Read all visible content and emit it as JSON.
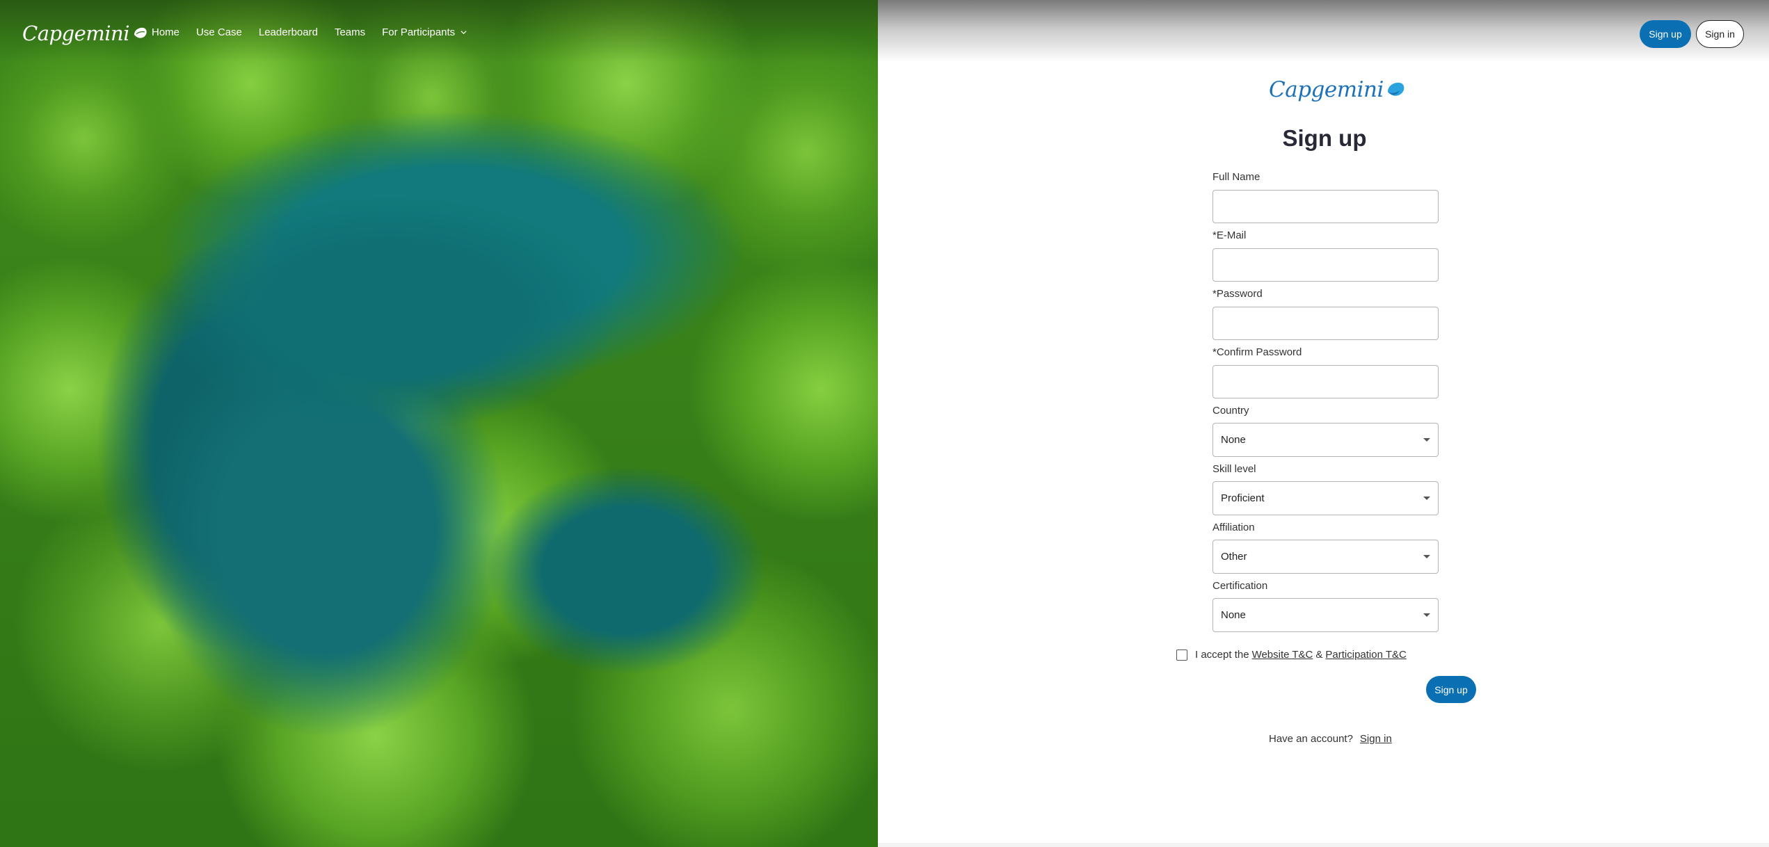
{
  "brand": {
    "name": "Capgemini",
    "brand_color": "#1d71b8"
  },
  "nav": {
    "items": [
      {
        "label": "Home"
      },
      {
        "label": "Use Case"
      },
      {
        "label": "Leaderboard"
      },
      {
        "label": "Teams"
      },
      {
        "label": "For Participants",
        "icon": "chevron-down-icon"
      }
    ]
  },
  "header_buttons": {
    "signup_label": "Sign up",
    "signin_label": "Sign in",
    "accent": "#0a6fb3"
  },
  "form": {
    "title": "Sign up",
    "full_name": {
      "label": "Full Name",
      "value": ""
    },
    "email": {
      "label": "*E-Mail",
      "value": ""
    },
    "password": {
      "label": "*Password",
      "value": ""
    },
    "confirm_password": {
      "label": "*Confirm Password",
      "value": ""
    },
    "country": {
      "label": "Country",
      "value": "None"
    },
    "skill_level": {
      "label": "Skill level",
      "value": "Proficient"
    },
    "affiliation": {
      "label": "Affiliation",
      "value": "Other"
    },
    "certification": {
      "label": "Certification",
      "value": "None"
    },
    "terms": {
      "prefix": "I accept the",
      "website_link": "Website T&C",
      "joiner": "&",
      "participation_link": "Participation T&C",
      "checked": false
    },
    "submit_label": "Sign up",
    "account_prompt": "Have an account?",
    "signin_link": "Sign in"
  }
}
